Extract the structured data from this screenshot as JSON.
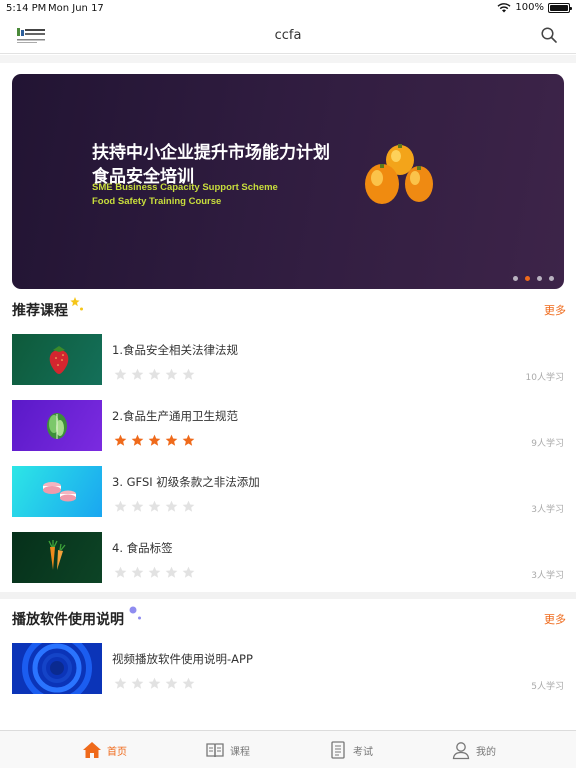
{
  "status": {
    "time": "5:14 PM",
    "date": "Mon Jun 17",
    "battery": "100%"
  },
  "nav": {
    "title": "ccfa",
    "logo_icon": "ccfa-logo-icon",
    "search_icon": "search-icon"
  },
  "banner": {
    "title_line1": "扶持中小企业提升市场能力计划",
    "title_line2": "食品安全培训",
    "subtitle_line1": "SME Business Capacity Support Scheme",
    "subtitle_line2": "Food Safety Training Course",
    "active_slide": 2,
    "slide_count": 4
  },
  "recommended": {
    "title": "推荐课程",
    "more": "更多",
    "courses": [
      {
        "title": "1.食品安全相关法律法规",
        "rating": 0,
        "count": "10人学习",
        "thumb_icon": "strawberry-icon"
      },
      {
        "title": "2.食品生产通用卫生规范",
        "rating": 5,
        "count": "9人学习",
        "thumb_icon": "lettuce-icon"
      },
      {
        "title": "3. GFSI 初级条款之非法添加",
        "rating": 0,
        "count": "3人学习",
        "thumb_icon": "macaron-icon"
      },
      {
        "title": "4. 食品标签",
        "rating": 0,
        "count": "3人学习",
        "thumb_icon": "carrot-icon"
      }
    ]
  },
  "guide": {
    "title": "播放软件使用说明",
    "more": "更多",
    "courses": [
      {
        "title": "视频播放软件使用说明-APP",
        "rating": 0,
        "count": "5人学习",
        "thumb_icon": "rings-icon"
      }
    ]
  },
  "tabs": [
    {
      "label": "首页",
      "icon": "home-icon",
      "active": true
    },
    {
      "label": "课程",
      "icon": "book-icon",
      "active": false
    },
    {
      "label": "考试",
      "icon": "document-icon",
      "active": false
    },
    {
      "label": "我的",
      "icon": "user-icon",
      "active": false
    }
  ],
  "colors": {
    "accent": "#ef6a1b",
    "star_empty": "#e2e2e2"
  }
}
